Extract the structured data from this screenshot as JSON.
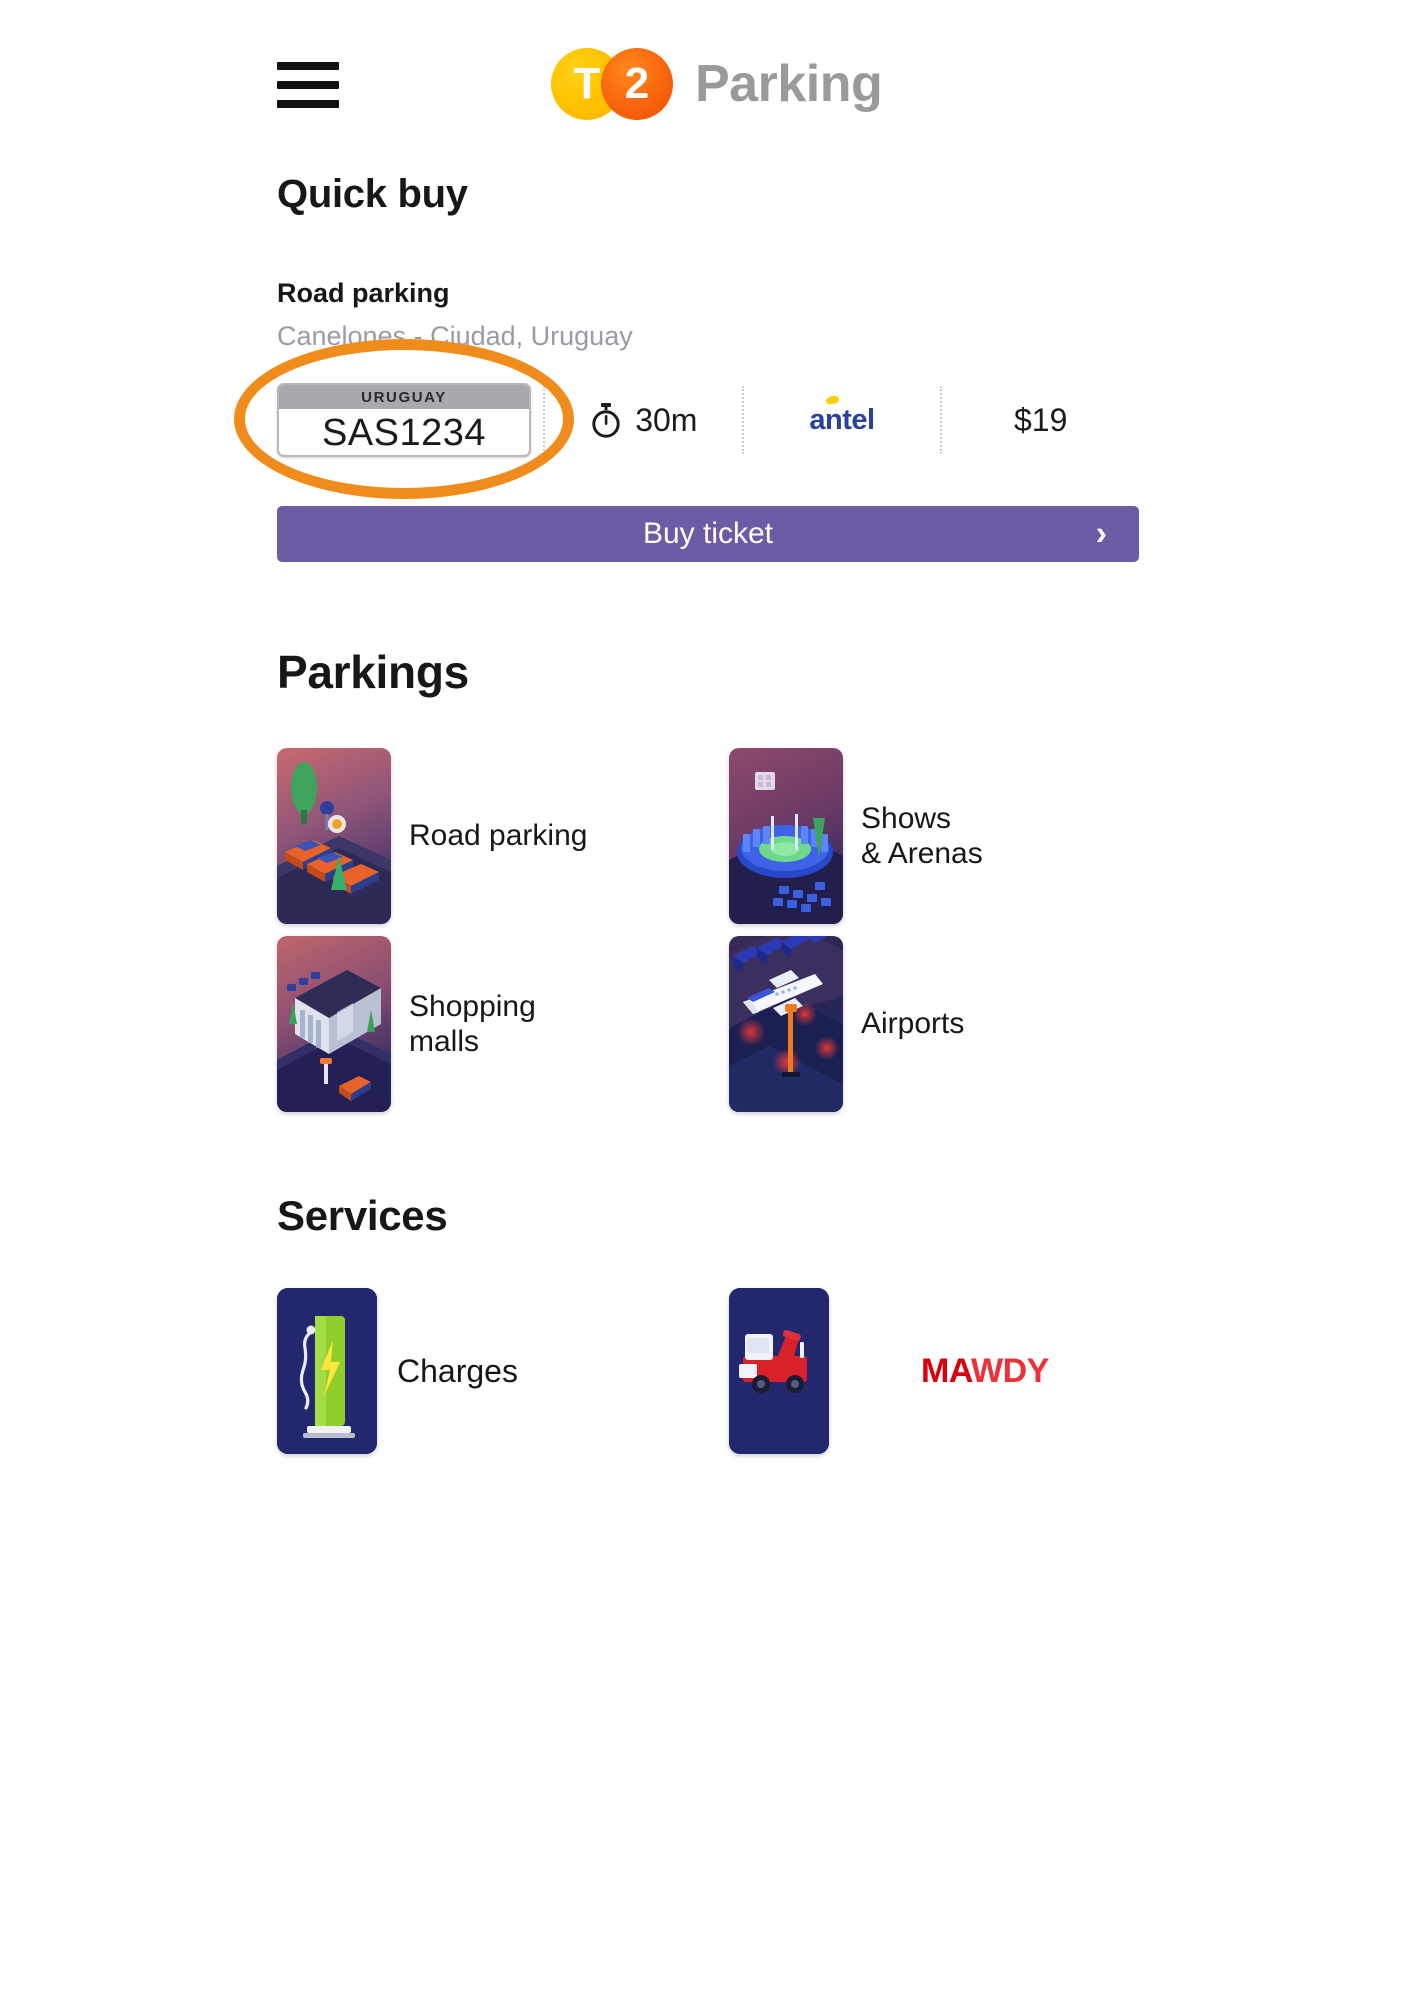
{
  "header": {
    "menu_icon": "hamburger-icon",
    "logo_first": "T",
    "logo_second": "2",
    "brand_name": "Parking"
  },
  "quick_buy": {
    "section_title": "Quick buy",
    "item_title": "Road parking",
    "item_location": "Canelones - Ciudad, Uruguay",
    "plate_country": "URUGUAY",
    "plate_number": "SAS1234",
    "duration": "30m",
    "duration_icon": "stopwatch-icon",
    "carrier": "antel",
    "price": "$19",
    "buy_label": "Buy ticket",
    "buy_chevron": "›",
    "highlight_color": "#f08c1c",
    "button_color": "#6e5ba6"
  },
  "parkings": {
    "section_title": "Parkings",
    "tiles": [
      {
        "label": "Road parking",
        "icon": "road-parking-thumbnail"
      },
      {
        "label": "Shows\n& Arenas",
        "icon": "shows-arenas-thumbnail"
      },
      {
        "label": "Shopping\nmalls",
        "icon": "shopping-malls-thumbnail"
      },
      {
        "label": "Airports",
        "icon": "airports-thumbnail"
      }
    ]
  },
  "services": {
    "section_title": "Services",
    "items": [
      {
        "label": "Charges",
        "icon": "ev-charging-station-icon"
      },
      {
        "label": "",
        "icon": "tow-truck-icon",
        "brand_dark": "MA",
        "brand_light": "WDY"
      }
    ]
  }
}
